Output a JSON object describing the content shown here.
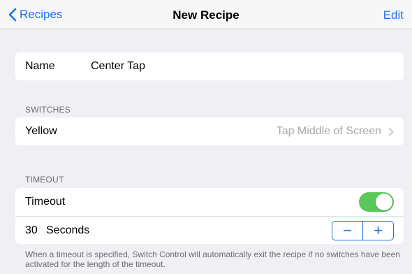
{
  "navbar": {
    "back_label": "Recipes",
    "title": "New Recipe",
    "edit_label": "Edit"
  },
  "name_row": {
    "label": "Name",
    "value": "Center Tap"
  },
  "switches": {
    "header": "SWITCHES",
    "item_label": "Yellow",
    "item_detail": "Tap Middle of Screen"
  },
  "timeout": {
    "header": "TIMEOUT",
    "toggle_label": "Timeout",
    "toggle_on": true,
    "value": "30",
    "unit": "Seconds",
    "minus_label": "−",
    "plus_label": "+"
  },
  "footer_note": "When a timeout is specified, Switch Control will automatically exit the recipe if no switches have been activated for the length of the timeout.",
  "colors": {
    "accent": "#1a73e8",
    "toggle_on": "#5ac85b",
    "background": "#efeff4"
  }
}
